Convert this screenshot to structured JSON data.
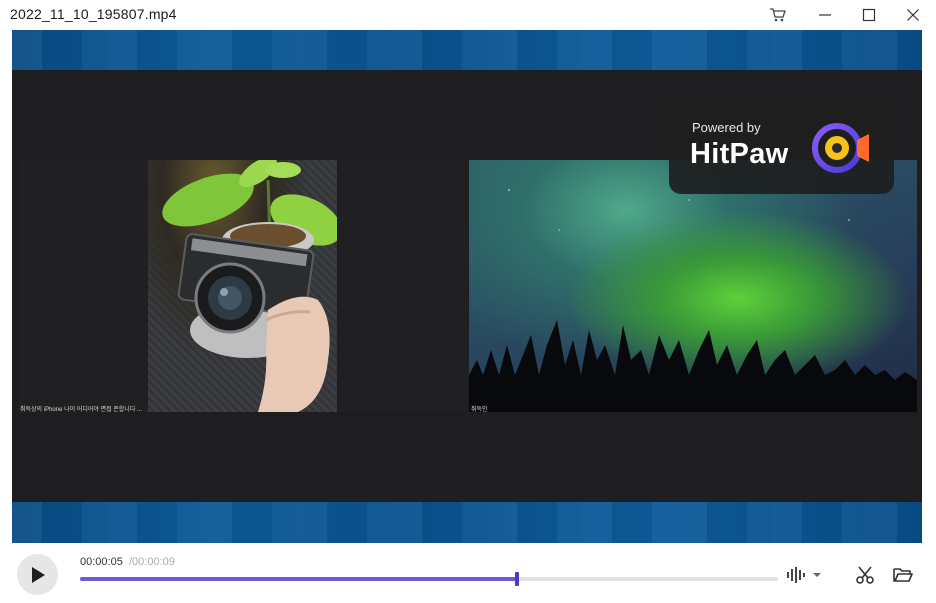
{
  "window": {
    "title": "2022_11_10_195807.mp4",
    "buttons": {
      "cart_icon": "cart-icon",
      "minimize_icon": "minimize-icon",
      "maximize_icon": "maximize-icon",
      "close_icon": "close-icon"
    }
  },
  "video": {
    "watermark": {
      "powered_by": "Powered by",
      "brand": "HitPaw"
    },
    "tiles": [
      {
        "caption": "취득상의 iPhone 나이 어디어야 면접 존합니다 ..."
      },
      {
        "caption": "취득인"
      }
    ]
  },
  "player": {
    "current_time": "00:00:05",
    "total_time": "/00:00:09",
    "progress": 0.626,
    "accent_color": "#6a5cd9",
    "icons": {
      "play": "play-icon",
      "audio": "audio-waveform-icon",
      "dropdown": "chevron-down-icon",
      "cut": "scissors-icon",
      "folder": "folder-open-icon"
    }
  }
}
